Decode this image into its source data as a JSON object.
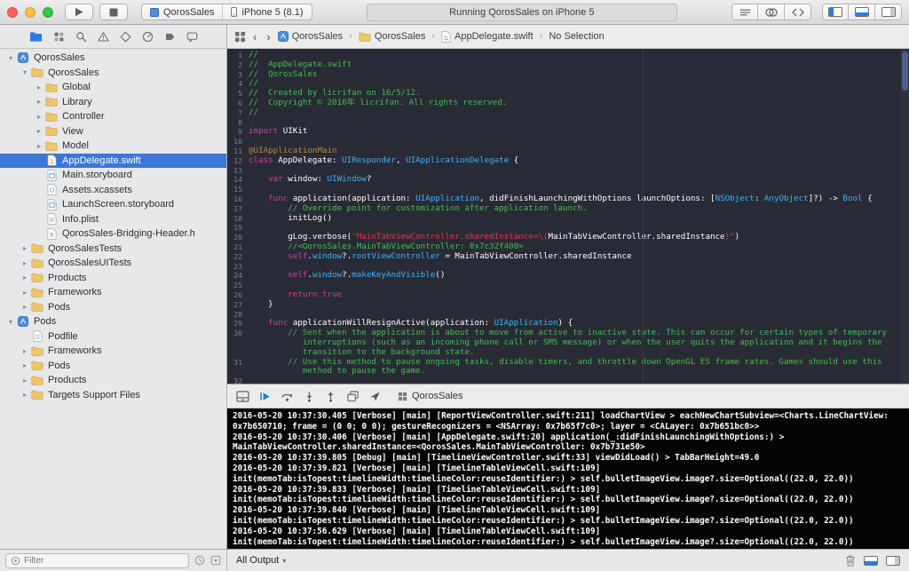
{
  "titlebar": {
    "scheme": "QorosSales",
    "destination": "iPhone 5 (8.1)",
    "status": "Running QorosSales on iPhone 5",
    "editor_buttons": [
      "standard-editor",
      "assistant-editor",
      "version-editor"
    ],
    "view_buttons": [
      {
        "name": "toggle-navigator",
        "band": "band-left",
        "active": true
      },
      {
        "name": "toggle-debug-area",
        "band": "band-bottom",
        "active": true
      },
      {
        "name": "toggle-utilities",
        "band": "band-right",
        "active": false
      }
    ]
  },
  "navigator_bar": {
    "icons": [
      {
        "name": "project-navigator",
        "active": true
      },
      {
        "name": "symbol-navigator",
        "active": false
      },
      {
        "name": "search-navigator",
        "active": false
      },
      {
        "name": "issue-navigator",
        "active": false
      },
      {
        "name": "test-navigator",
        "active": false
      },
      {
        "name": "debug-navigator",
        "active": false
      },
      {
        "name": "breakpoint-navigator",
        "active": false
      },
      {
        "name": "report-navigator",
        "active": false
      }
    ]
  },
  "sidebar": {
    "filter_placeholder": "Filter",
    "tree": [
      {
        "label": "QorosSales",
        "icon": "project",
        "level": 0,
        "disclosure": "open"
      },
      {
        "label": "QorosSales",
        "icon": "folder",
        "level": 1,
        "disclosure": "open"
      },
      {
        "label": "Global",
        "icon": "folder",
        "level": 2,
        "disclosure": "closed"
      },
      {
        "label": "Library",
        "icon": "folder",
        "level": 2,
        "disclosure": "closed"
      },
      {
        "label": "Controller",
        "icon": "folder",
        "level": 2,
        "disclosure": "closed"
      },
      {
        "label": "View",
        "icon": "folder",
        "level": 2,
        "disclosure": "closed"
      },
      {
        "label": "Model",
        "icon": "folder",
        "level": 2,
        "disclosure": "closed"
      },
      {
        "label": "AppDelegate.swift",
        "icon": "swift",
        "level": 2,
        "disclosure": "none",
        "selected": true
      },
      {
        "label": "Main.storyboard",
        "icon": "storyboard",
        "level": 2,
        "disclosure": "none"
      },
      {
        "label": "Assets.xcassets",
        "icon": "xcassets",
        "level": 2,
        "disclosure": "none"
      },
      {
        "label": "LaunchScreen.storyboard",
        "icon": "storyboard",
        "level": 2,
        "disclosure": "none"
      },
      {
        "label": "Info.plist",
        "icon": "plist",
        "level": 2,
        "disclosure": "none"
      },
      {
        "label": "QorosSales-Bridging-Header.h",
        "icon": "header",
        "level": 2,
        "disclosure": "none"
      },
      {
        "label": "QorosSalesTests",
        "icon": "folder",
        "level": 1,
        "disclosure": "closed"
      },
      {
        "label": "QorosSalesUITests",
        "icon": "folder",
        "level": 1,
        "disclosure": "closed"
      },
      {
        "label": "Products",
        "icon": "folder",
        "level": 1,
        "disclosure": "closed"
      },
      {
        "label": "Frameworks",
        "icon": "folder",
        "level": 1,
        "disclosure": "closed"
      },
      {
        "label": "Pods",
        "icon": "folder",
        "level": 1,
        "disclosure": "closed"
      },
      {
        "label": "Pods",
        "icon": "project",
        "level": 0,
        "disclosure": "open"
      },
      {
        "label": "Podfile",
        "icon": "file",
        "level": 1,
        "disclosure": "none"
      },
      {
        "label": "Frameworks",
        "icon": "folder",
        "level": 1,
        "disclosure": "closed"
      },
      {
        "label": "Pods",
        "icon": "folder",
        "level": 1,
        "disclosure": "closed"
      },
      {
        "label": "Products",
        "icon": "folder",
        "level": 1,
        "disclosure": "closed"
      },
      {
        "label": "Targets Support Files",
        "icon": "folder",
        "level": 1,
        "disclosure": "closed"
      }
    ]
  },
  "jumpbar": {
    "segments": [
      {
        "icon": "project",
        "label": "QorosSales"
      },
      {
        "icon": "folder",
        "label": "QorosSales"
      },
      {
        "icon": "swift",
        "label": "AppDelegate.swift"
      },
      {
        "icon": "none",
        "label": "No Selection"
      }
    ]
  },
  "editor": {
    "lines": [
      {
        "n": 1,
        "seg": [
          [
            "cm",
            "//"
          ]
        ]
      },
      {
        "n": 2,
        "seg": [
          [
            "cm",
            "//  AppDelegate.swift"
          ]
        ]
      },
      {
        "n": 3,
        "seg": [
          [
            "cm",
            "//  QorosSales"
          ]
        ]
      },
      {
        "n": 4,
        "seg": [
          [
            "cm",
            "//"
          ]
        ]
      },
      {
        "n": 5,
        "seg": [
          [
            "cm",
            "//  Created by licrifan on 16/5/12."
          ]
        ]
      },
      {
        "n": 6,
        "seg": [
          [
            "cm",
            "//  Copyright © 2016年 licrifan. All rights reserved."
          ]
        ]
      },
      {
        "n": 7,
        "seg": [
          [
            "cm",
            "//"
          ]
        ]
      },
      {
        "n": 8,
        "seg": []
      },
      {
        "n": 9,
        "seg": [
          [
            "k",
            "import"
          ],
          [
            "p",
            " UIKit"
          ]
        ]
      },
      {
        "n": 10,
        "seg": []
      },
      {
        "n": 11,
        "seg": [
          [
            "a",
            "@UIApplicationMain"
          ]
        ]
      },
      {
        "n": 12,
        "seg": [
          [
            "k",
            "class"
          ],
          [
            "p",
            " AppDelegate: "
          ],
          [
            "t",
            "UIResponder"
          ],
          [
            "p",
            ", "
          ],
          [
            "t",
            "UIApplicationDelegate"
          ],
          [
            "p",
            " {"
          ]
        ]
      },
      {
        "n": 13,
        "seg": []
      },
      {
        "n": 14,
        "seg": [
          [
            "p",
            "    "
          ],
          [
            "k",
            "var"
          ],
          [
            "p",
            " window: "
          ],
          [
            "t",
            "UIWindow"
          ],
          [
            "p",
            "?"
          ]
        ]
      },
      {
        "n": 15,
        "seg": []
      },
      {
        "n": 16,
        "seg": [
          [
            "p",
            "    "
          ],
          [
            "k",
            "func"
          ],
          [
            "p",
            " application(application: "
          ],
          [
            "t",
            "UIApplication"
          ],
          [
            "p",
            ", didFinishLaunchingWithOptions launchOptions: ["
          ],
          [
            "t",
            "NSObject"
          ],
          [
            "p",
            ": "
          ],
          [
            "t",
            "AnyObject"
          ],
          [
            "p",
            "]?) -> "
          ],
          [
            "t",
            "Bool"
          ],
          [
            "p",
            " {"
          ]
        ]
      },
      {
        "n": 17,
        "seg": [
          [
            "cm",
            "        // Override point for customization after application launch."
          ]
        ]
      },
      {
        "n": 18,
        "seg": [
          [
            "p",
            "        initLog()"
          ]
        ]
      },
      {
        "n": 19,
        "seg": []
      },
      {
        "n": 20,
        "seg": [
          [
            "p",
            "        gLog.verbose("
          ],
          [
            "s",
            "\"MainTabViewController.sharedInstance=\\("
          ],
          [
            "p",
            "MainTabViewController.sharedInstance"
          ],
          [
            "s",
            ")\""
          ],
          [
            "p",
            ")"
          ]
        ]
      },
      {
        "n": 21,
        "seg": [
          [
            "cm",
            "        //<QorosSales.MainTabViewController: 0x7c32f400>"
          ]
        ]
      },
      {
        "n": 22,
        "seg": [
          [
            "p",
            "        "
          ],
          [
            "k",
            "self"
          ],
          [
            "p",
            "."
          ],
          [
            "t",
            "window"
          ],
          [
            "p",
            "?."
          ],
          [
            "t",
            "rootViewController"
          ],
          [
            "p",
            " = MainTabViewController.sharedInstance"
          ]
        ]
      },
      {
        "n": 23,
        "seg": []
      },
      {
        "n": 24,
        "seg": [
          [
            "p",
            "        "
          ],
          [
            "k",
            "self"
          ],
          [
            "p",
            "."
          ],
          [
            "t",
            "window"
          ],
          [
            "p",
            "?."
          ],
          [
            "t",
            "makeKeyAndVisible"
          ],
          [
            "p",
            "()"
          ]
        ]
      },
      {
        "n": 25,
        "seg": []
      },
      {
        "n": 26,
        "seg": [
          [
            "p",
            "        "
          ],
          [
            "k",
            "return"
          ],
          [
            "p",
            " "
          ],
          [
            "k",
            "true"
          ]
        ]
      },
      {
        "n": 27,
        "seg": [
          [
            "p",
            "    }"
          ]
        ]
      },
      {
        "n": 28,
        "seg": []
      },
      {
        "n": 29,
        "seg": [
          [
            "p",
            "    "
          ],
          [
            "k",
            "func"
          ],
          [
            "p",
            " applicationWillResignActive(application: "
          ],
          [
            "t",
            "UIApplication"
          ],
          [
            "p",
            ") {"
          ]
        ]
      },
      {
        "n": 30,
        "hang": 11,
        "seg": [
          [
            "cm",
            "        // Sent when the application is about to move from active to inactive state. This can occur for certain types of temporary interruptions (such as an incoming phone call or SMS message) or when the user quits the application and it begins the transition to the background state."
          ]
        ]
      },
      {
        "n": 31,
        "hang": 11,
        "seg": [
          [
            "cm",
            "        // Use this method to pause ongoing tasks, disable timers, and throttle down OpenGL ES frame rates. Games should use this method to pause the game."
          ]
        ]
      },
      {
        "n": 32,
        "seg": []
      }
    ]
  },
  "debugbar": {
    "icons": [
      "hide-console",
      "continue",
      "step-over",
      "step-into",
      "step-out",
      "view-debugger",
      "location"
    ],
    "process": "QorosSales"
  },
  "console": {
    "rows": [
      "2016-05-20 10:37:30.405 [Verbose] [main] [ReportViewController.swift:211] loadChartView > eachNewChartSubview=<Charts.LineChartView:",
      "0x7b650710; frame = (0 0; 0 0); gestureRecognizers = <NSArray: 0x7b65f7c0>; layer = <CALayer: 0x7b651bc0>>",
      "2016-05-20 10:37:30.406 [Verbose] [main] [AppDelegate.swift:20] application(_:didFinishLaunchingWithOptions:) >",
      "MainTabViewController.sharedInstance=<QorosSales.MainTabViewController: 0x7b731e50>",
      "2016-05-20 10:37:39.805 [Debug] [main] [TimelineViewController.swift:33] viewDidLoad() > TabBarHeight=49.0",
      "2016-05-20 10:37:39.821 [Verbose] [main] [TimelineTableViewCell.swift:109]",
      "init(memoTab:isTopest:timelineWidth:timelineColor:reuseIdentifier:) > self.bulletImageView.image?.size=Optional((22.0, 22.0))",
      "2016-05-20 10:37:39.833 [Verbose] [main] [TimelineTableViewCell.swift:109]",
      "init(memoTab:isTopest:timelineWidth:timelineColor:reuseIdentifier:) > self.bulletImageView.image?.size=Optional((22.0, 22.0))",
      "2016-05-20 10:37:39.840 [Verbose] [main] [TimelineTableViewCell.swift:109]",
      "init(memoTab:isTopest:timelineWidth:timelineColor:reuseIdentifier:) > self.bulletImageView.image?.size=Optional((22.0, 22.0))",
      "2016-05-20 10:37:56.629 [Verbose] [main] [TimelineTableViewCell.swift:109]",
      "init(memoTab:isTopest:timelineWidth:timelineColor:reuseIdentifier:) > self.bulletImageView.image?.size=Optional((22.0, 22.0))"
    ]
  },
  "bottombar": {
    "all_output": "All Output"
  }
}
